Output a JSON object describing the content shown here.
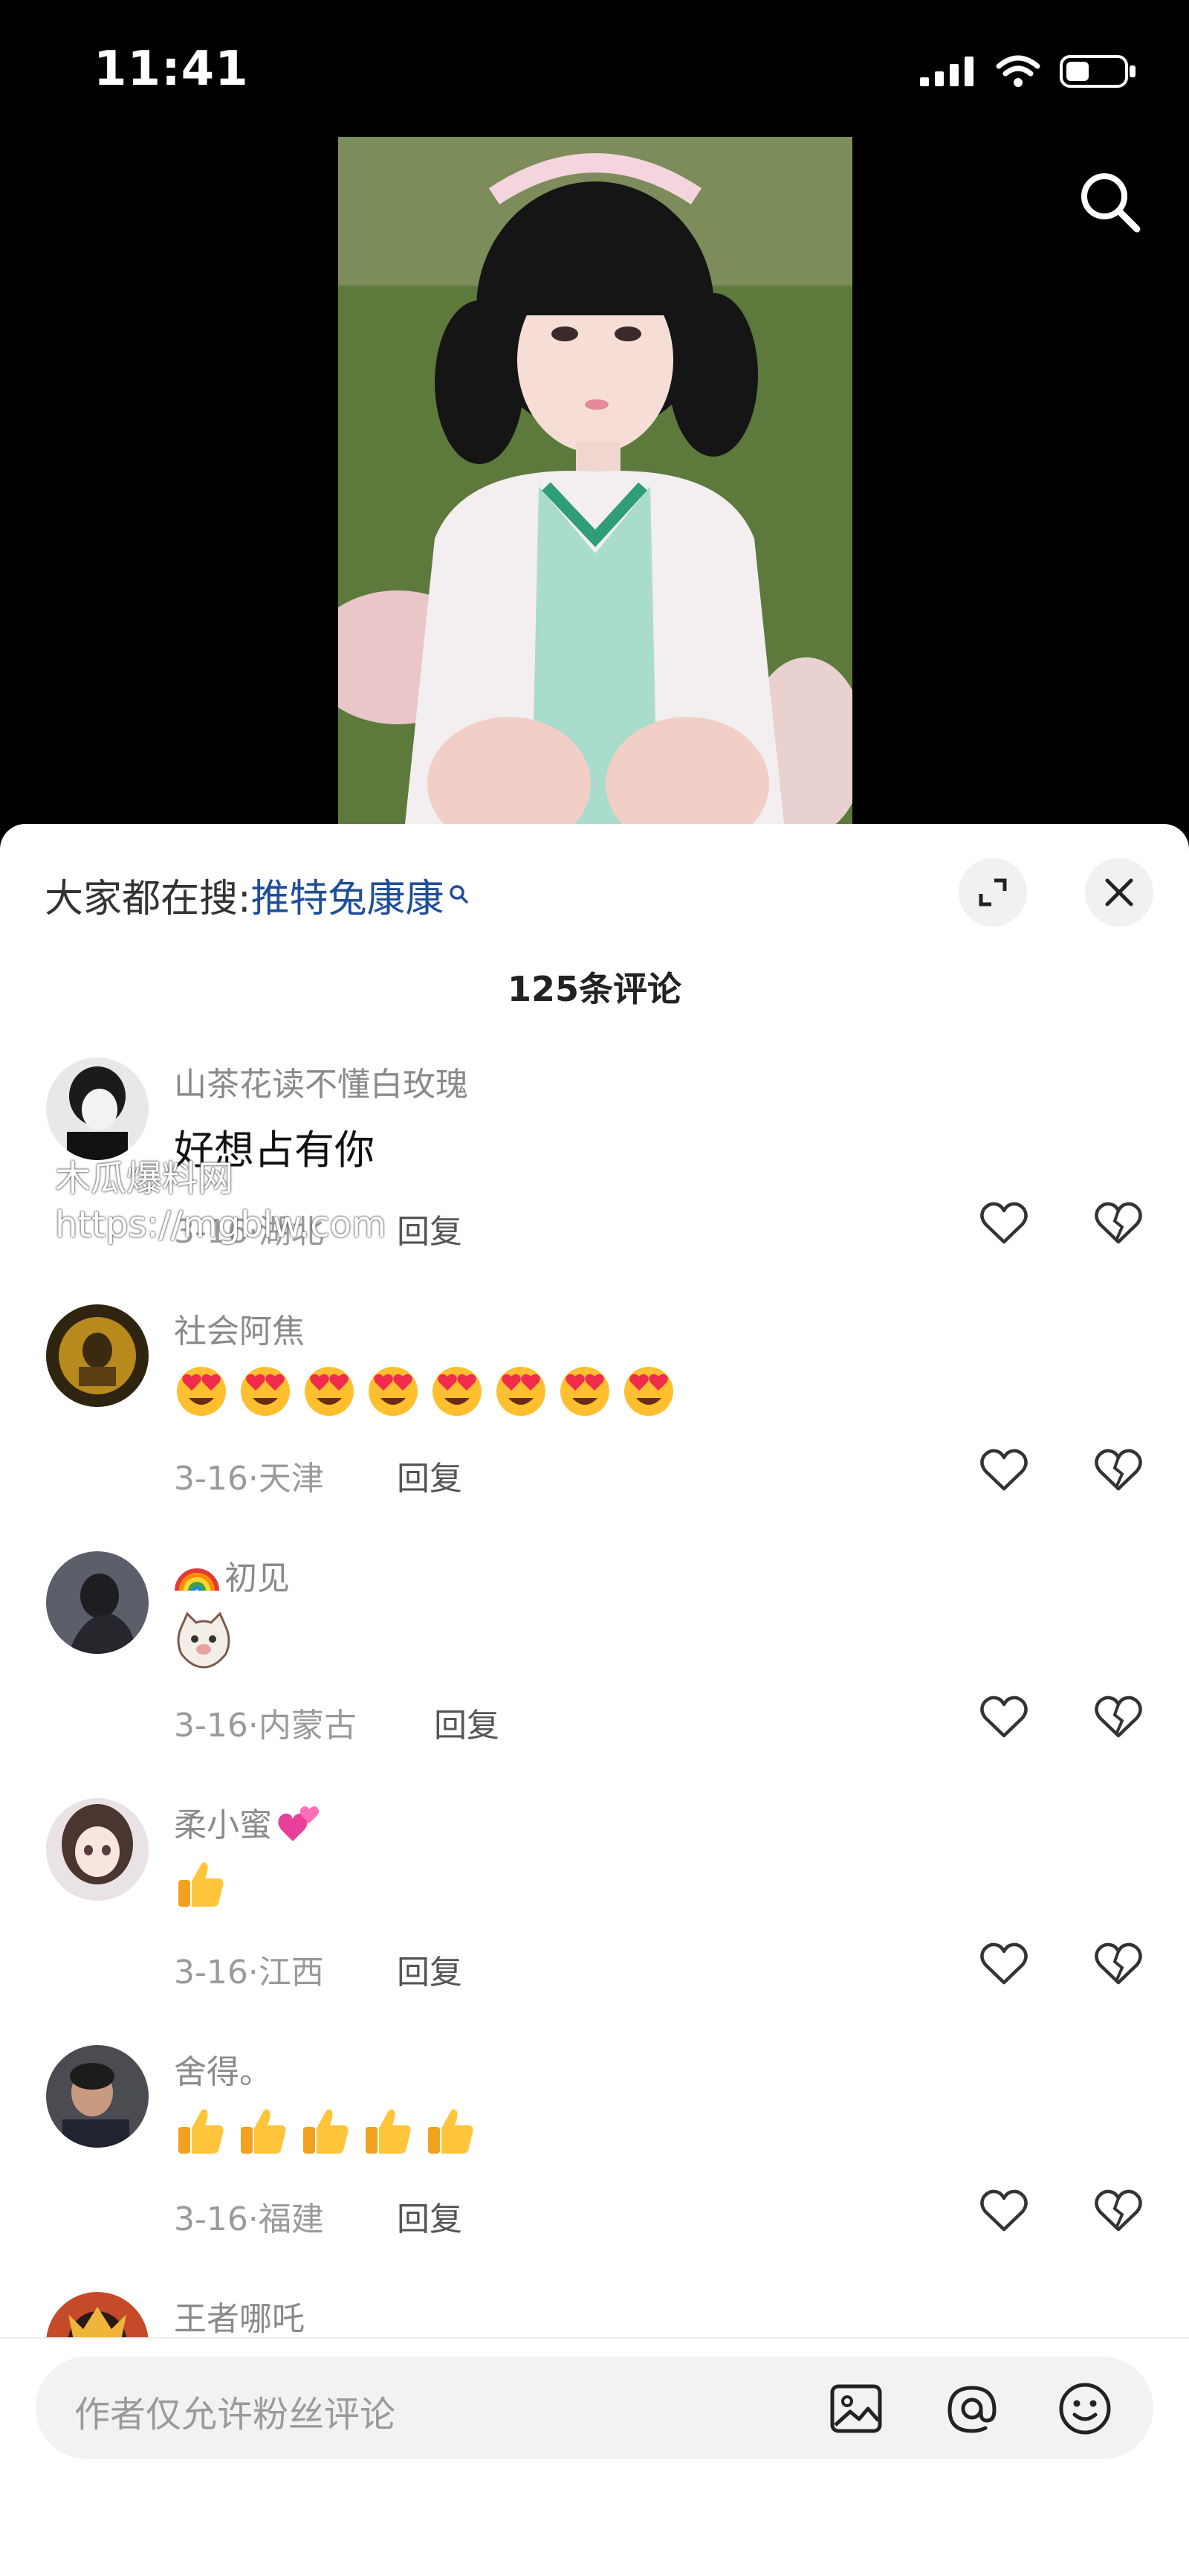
{
  "status_bar": {
    "time": "11:41"
  },
  "header": {
    "search_icon": "search-icon"
  },
  "hot_search": {
    "prefix": "大家都在搜:",
    "term": "推特兔康康"
  },
  "comments_count": "125条评论",
  "comments": [
    {
      "username": "山茶花读不懂白玫瑰",
      "text": "好想占有你",
      "date": "3-16",
      "location": "湖北",
      "reply": "回复"
    },
    {
      "username": "社会阿焦",
      "emoji": "heart-eyes-emoji",
      "emoji_count": 8,
      "date": "3-16",
      "location": "天津",
      "reply": "回复"
    },
    {
      "username": "初见",
      "username_prefix_emoji": "rainbow-emoji",
      "emoji": "cat-face-emoji",
      "date": "3-16",
      "location": "内蒙古",
      "reply": "回复"
    },
    {
      "username": "柔小蜜",
      "username_suffix_emoji": "two-hearts-emoji",
      "emoji": "thumbs-up-emoji",
      "emoji_count": 1,
      "date": "3-16",
      "location": "江西",
      "reply": "回复"
    },
    {
      "username": "舍得。",
      "emoji": "thumbs-up-emoji",
      "emoji_count": 5,
      "date": "3-16",
      "location": "福建",
      "reply": "回复"
    },
    {
      "username": "王者哪吒"
    }
  ],
  "input": {
    "placeholder": "作者仅允许粉丝评论"
  },
  "watermark": {
    "line1": "木瓜爆料网",
    "line2": "https://mgblw.com"
  },
  "colors": {
    "hot_term": "#1f4e99",
    "meta": "#9a9a9a",
    "background": "#000000"
  }
}
